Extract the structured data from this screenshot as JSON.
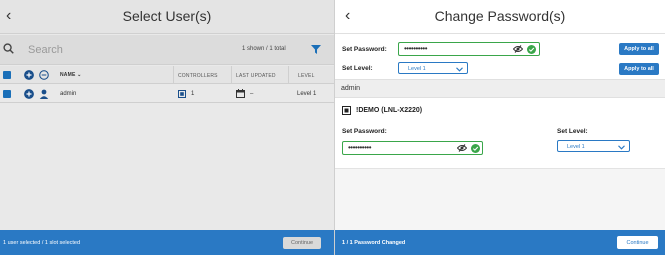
{
  "left_panel": {
    "back_icon": "chevron-left-icon",
    "title": "Select User(s)",
    "search": {
      "placeholder": "Search",
      "value": ""
    },
    "shown_count": "1 shown / 1 total",
    "columns": {
      "name": "NAME",
      "controllers": "CONTROLLERS",
      "last_updated": "LAST UPDATED",
      "level": "LEVEL"
    },
    "rows": [
      {
        "name": "admin",
        "controllers": "1",
        "last_updated": "–",
        "level": "Level 1",
        "selected": true
      }
    ],
    "footer": {
      "status": "1 user selected / 1 slot selected",
      "continue_label": "Continue"
    }
  },
  "right_panel": {
    "back_icon": "chevron-left-icon",
    "title": "Change Password(s)",
    "global": {
      "set_password_label": "Set Password:",
      "password_value": "••••••••••",
      "set_level_label": "Set Level:",
      "level_value": "Level 1",
      "apply_all_label_1": "Apply to all",
      "apply_all_label_2": "Apply to all"
    },
    "user": {
      "name": "admin",
      "controller_name": "!DEMO (LNL-X2220)",
      "set_password_label": "Set Password:",
      "password_value": "••••••••••",
      "set_level_label": "Set Level:",
      "level_value": "Level 1"
    },
    "footer": {
      "status": "1 / 1 Password Changed",
      "continue_label": "Continue"
    }
  },
  "colors": {
    "accent": "#2a79c4",
    "success": "#3aa64a",
    "footer_blue": "#2a79c4",
    "panel_gray": "#e9e9e9"
  }
}
